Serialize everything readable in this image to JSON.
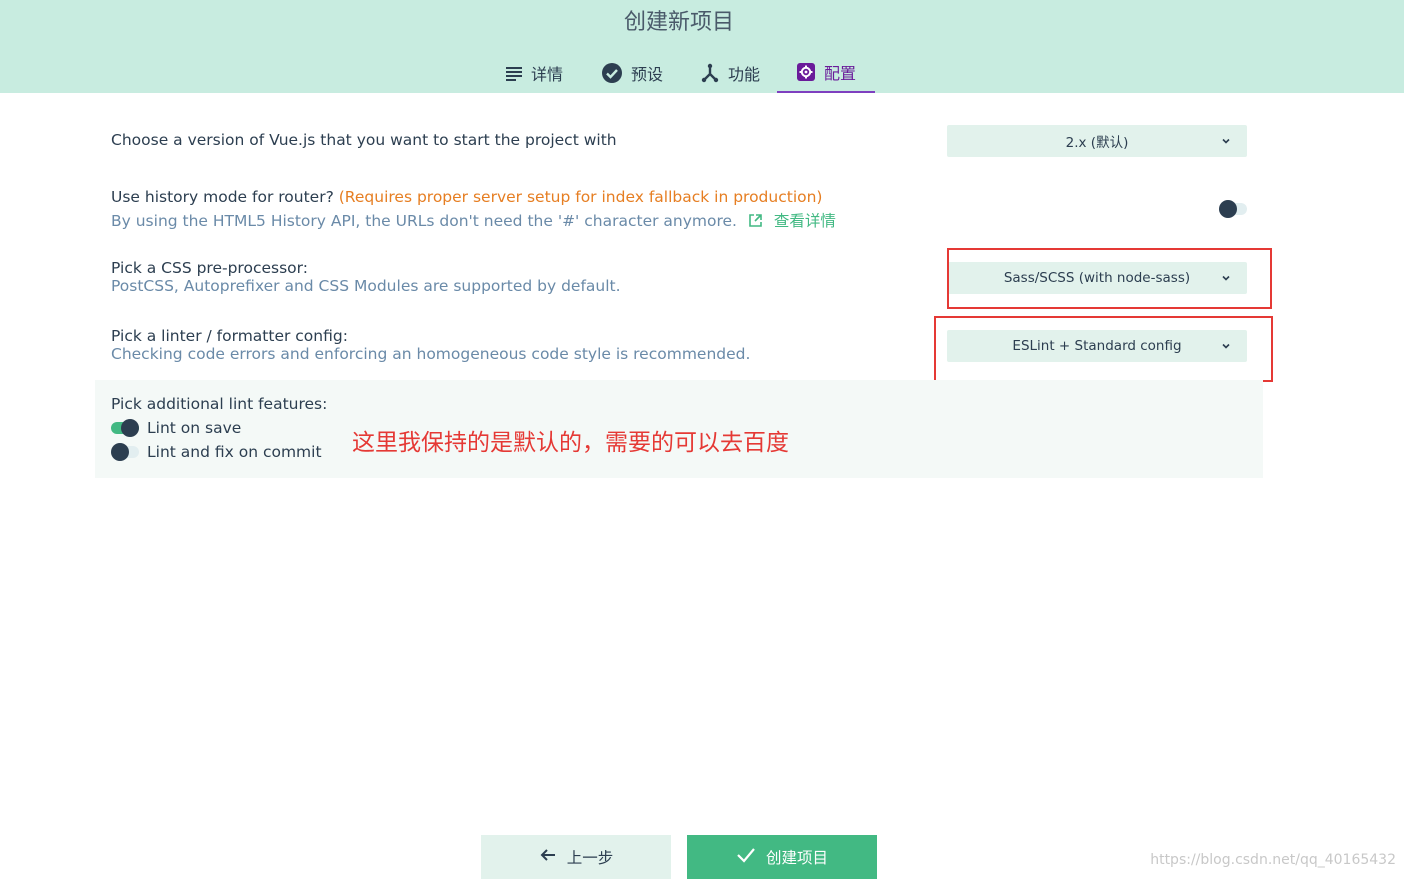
{
  "header": {
    "title": "创建新项目",
    "tabs": [
      {
        "label": "详情",
        "icon": "list-icon",
        "active": false
      },
      {
        "label": "预设",
        "icon": "check-circle-icon",
        "active": false
      },
      {
        "label": "功能",
        "icon": "fork-icon",
        "active": false
      },
      {
        "label": "配置",
        "icon": "gear-icon",
        "active": true
      }
    ]
  },
  "config": {
    "vue_version": {
      "label": "Choose a version of Vue.js that you want to start the project with",
      "value": "2.x (默认)"
    },
    "router_history": {
      "label": "Use history mode for router?",
      "warning": "(Requires proper server setup for index fallback in production)",
      "description": "By using the HTML5 History API, the URLs don't need the '#' character anymore.",
      "more_link": "查看详情",
      "enabled": false
    },
    "css_preprocessor": {
      "label": "Pick a CSS pre-processor:",
      "description": "PostCSS, Autoprefixer and CSS Modules are supported by default.",
      "value": "Sass/SCSS (with node-sass)"
    },
    "linter": {
      "label": "Pick a linter / formatter config:",
      "description": "Checking code errors and enforcing an homogeneous code style is recommended.",
      "value": "ESLint + Standard config"
    },
    "lint_features": {
      "label": "Pick additional lint features:",
      "items": [
        {
          "label": "Lint on save",
          "enabled": true
        },
        {
          "label": "Lint and fix on commit",
          "enabled": false
        }
      ]
    }
  },
  "annotation": "这里我保持的是默认的，需要的可以去百度",
  "actions": {
    "prev_label": "上一步",
    "create_label": "创建项目"
  },
  "watermark": "https://blog.csdn.net/qq_40165432",
  "colors": {
    "header_bg": "#c8ece0",
    "accent": "#42b983",
    "active_tab": "#7e3fbf",
    "warning": "#e67e22",
    "annotation": "#e53935"
  }
}
